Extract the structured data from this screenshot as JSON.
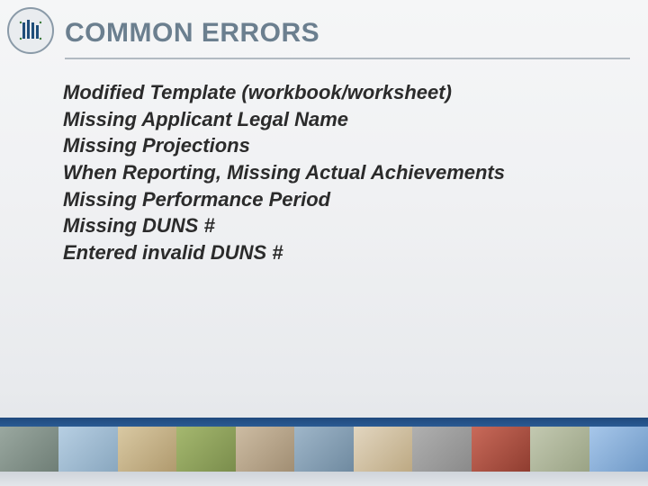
{
  "title": "COMMON ERRORS",
  "bullets": [
    "Modified Template (workbook/worksheet)",
    "Missing Applicant Legal Name",
    "Missing Projections",
    "When Reporting, Missing Actual Achievements",
    "Missing Performance Period",
    "Missing DUNS #",
    "Entered invalid DUNS #"
  ],
  "logo_name": "agency-seal",
  "colors": {
    "title": "#6b7f8f",
    "rule": "#7b8a98",
    "footer_bar": "#1f497d"
  }
}
